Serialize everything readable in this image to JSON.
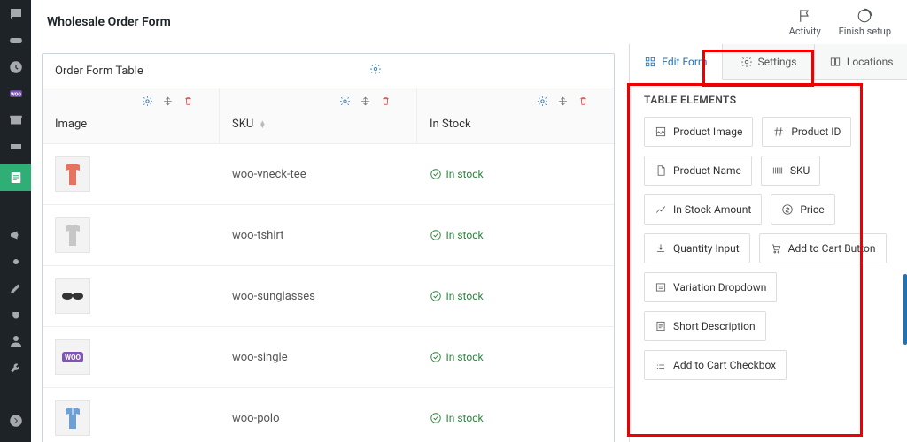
{
  "header": {
    "title": "Wholesale Order Form",
    "activity": "Activity",
    "finish": "Finish setup"
  },
  "form": {
    "panel_title": "Order Form Table",
    "columns": {
      "image": "Image",
      "sku": "SKU",
      "in_stock": "In Stock"
    }
  },
  "rows": [
    {
      "sku": "woo-vneck-tee",
      "stock": "In stock",
      "thumb": "tshirt-red"
    },
    {
      "sku": "woo-tshirt",
      "stock": "In stock",
      "thumb": "tshirt-grey"
    },
    {
      "sku": "woo-sunglasses",
      "stock": "In stock",
      "thumb": "sunglasses"
    },
    {
      "sku": "woo-single",
      "stock": "In stock",
      "thumb": "woo-badge"
    },
    {
      "sku": "woo-polo",
      "stock": "In stock",
      "thumb": "polo-blue"
    }
  ],
  "panel": {
    "tabs": {
      "edit": "Edit Form",
      "settings": "Settings",
      "locations": "Locations"
    },
    "section": "TABLE ELEMENTS",
    "elements": {
      "product_image": "Product Image",
      "product_id": "Product ID",
      "product_name": "Product Name",
      "sku": "SKU",
      "in_stock_amount": "In Stock Amount",
      "price": "Price",
      "quantity_input": "Quantity Input",
      "add_to_cart_button": "Add to Cart Button",
      "variation_dropdown": "Variation Dropdown",
      "short_description": "Short Description",
      "add_to_cart_checkbox": "Add to Cart Checkbox"
    }
  }
}
